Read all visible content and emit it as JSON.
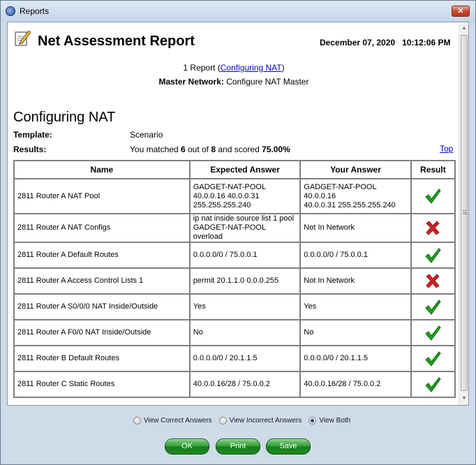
{
  "window": {
    "title": "Reports",
    "close_glyph": "✕"
  },
  "report": {
    "title": "Net Assessment Report",
    "date": "December 07, 2020   10:12:06 PM",
    "summary_prefix": "1 Report (",
    "summary_link": "Configuring NAT",
    "summary_suffix": ")",
    "master_label": "Master Network:",
    "master_value": " Configure NAT Master"
  },
  "section": {
    "title": "Configuring NAT",
    "template_label": "Template:",
    "template_value": "Scenario",
    "results_label": "Results:",
    "results_pre": "You matched ",
    "matched": "6",
    "results_mid": " out of ",
    "total": "8",
    "results_mid2": " and scored ",
    "score": "75.00%",
    "top_link": "Top"
  },
  "table": {
    "headers": [
      "Name",
      "Expected Answer",
      "Your Answer",
      "Result"
    ],
    "rows": [
      {
        "name": "2811 Router A NAT Pool",
        "expected": [
          "GADGET-NAT-POOL",
          "40.0.0.16 40.0.0.31",
          "255.255.255.240"
        ],
        "yours": [
          "GADGET-NAT-POOL 40.0.0.16",
          "40.0.0.31 255.255.255.240"
        ],
        "result": "correct"
      },
      {
        "name": "2811 Router A NAT Configs",
        "expected": [
          "ip nat inside source list 1 pool",
          "GADGET-NAT-POOL overload"
        ],
        "yours": [
          "Not In Network"
        ],
        "result": "incorrect"
      },
      {
        "name": "2811 Router A Default Routes",
        "expected": [
          "0.0.0.0/0 / 75.0.0.1"
        ],
        "yours": [
          "0.0.0.0/0 / 75.0.0.1"
        ],
        "result": "correct"
      },
      {
        "name": "2811 Router A Access Control Lists 1",
        "expected": [
          "permit 20.1.1.0 0.0.0.255"
        ],
        "yours": [
          "Not In Network"
        ],
        "result": "incorrect"
      },
      {
        "name": "2811 Router A S0/0/0 NAT Inside/Outside",
        "expected": [
          "Yes"
        ],
        "yours": [
          "Yes"
        ],
        "result": "correct"
      },
      {
        "name": "2811 Router A F0/0 NAT Inside/Outside",
        "expected": [
          "No"
        ],
        "yours": [
          "No"
        ],
        "result": "correct"
      },
      {
        "name": "2811 Router B Default Routes",
        "expected": [
          "0.0.0.0/0 / 20.1.1.5"
        ],
        "yours": [
          "0.0.0.0/0 / 20.1.1.5"
        ],
        "result": "correct"
      },
      {
        "name": "2811 Router C Static Routes",
        "expected": [
          "40.0.0.16/28 / 75.0.0.2"
        ],
        "yours": [
          "40.0.0.16/28 / 75.0.0.2"
        ],
        "result": "correct"
      }
    ],
    "row_heights": [
      50,
      38,
      37,
      37,
      37,
      37,
      37,
      37
    ]
  },
  "view_options": [
    {
      "label": "View Correct Answers",
      "checked": false
    },
    {
      "label": "View Incorrect Answers",
      "checked": false
    },
    {
      "label": "View Both",
      "checked": true
    }
  ],
  "buttons": {
    "ok": "OK",
    "print": "Print",
    "save": "Save"
  },
  "colors": {
    "correct": "#1aa61a",
    "incorrect": "#d42020",
    "button_green": "#2f9a33",
    "link": "#0000cc"
  },
  "icons": {
    "correct": "check-mark-icon",
    "incorrect": "x-mark-icon",
    "report": "report-pencil-icon"
  }
}
